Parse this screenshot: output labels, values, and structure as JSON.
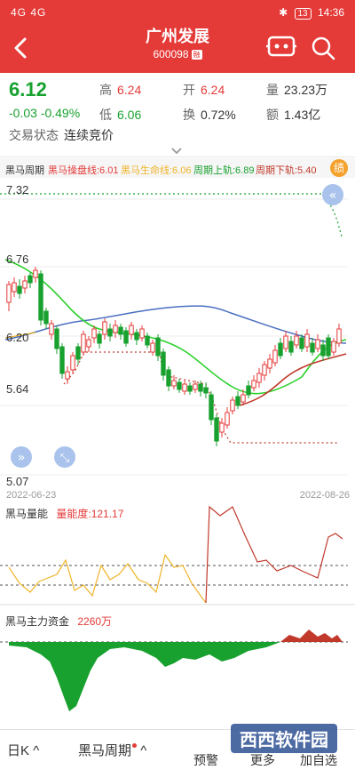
{
  "status": {
    "time": "14:36",
    "battery": "13",
    "signal": "4G 4G"
  },
  "header": {
    "title": "广州发展",
    "code": "600098",
    "badge": "融"
  },
  "quote": {
    "price": "6.12",
    "change": "-0.03",
    "change_pct": "-0.49%",
    "high_label": "高",
    "high": "6.24",
    "open_label": "开",
    "open": "6.24",
    "volume_label": "量",
    "volume": "23.23万",
    "low_label": "低",
    "low": "6.06",
    "turnover_label": "换",
    "turnover": "0.72%",
    "amount_label": "额",
    "amount": "1.43亿",
    "status_label": "交易状态",
    "status": "连续竞价"
  },
  "indicator": {
    "name": "黑马周期",
    "l1": "黑马操盘线:6.01",
    "l2": "黑马生命线:6.06",
    "l3": "周期上轨:6.89",
    "l4": "周期下轨:5.40",
    "badge": "绩"
  },
  "main_chart": {
    "y_labels": [
      "7.32",
      "6.76",
      "6.20",
      "5.64",
      "5.07"
    ],
    "start_date": "2022-06-23",
    "end_date": "2022-08-26"
  },
  "volume_panel": {
    "name": "黑马量能",
    "label": "量能度:",
    "value": "121.17"
  },
  "fund_panel": {
    "name": "黑马主力资金",
    "value": "2260万"
  },
  "tabs": {
    "day": "日K",
    "cycle": "黑马周期",
    "t3": "预警",
    "t4": "更多",
    "t5": "加自选"
  },
  "watermark": "西西软件园",
  "colors": {
    "up": "#e43a38",
    "down": "#18a12f",
    "blue": "#4b6fc2",
    "yellow": "#f0b428"
  }
}
